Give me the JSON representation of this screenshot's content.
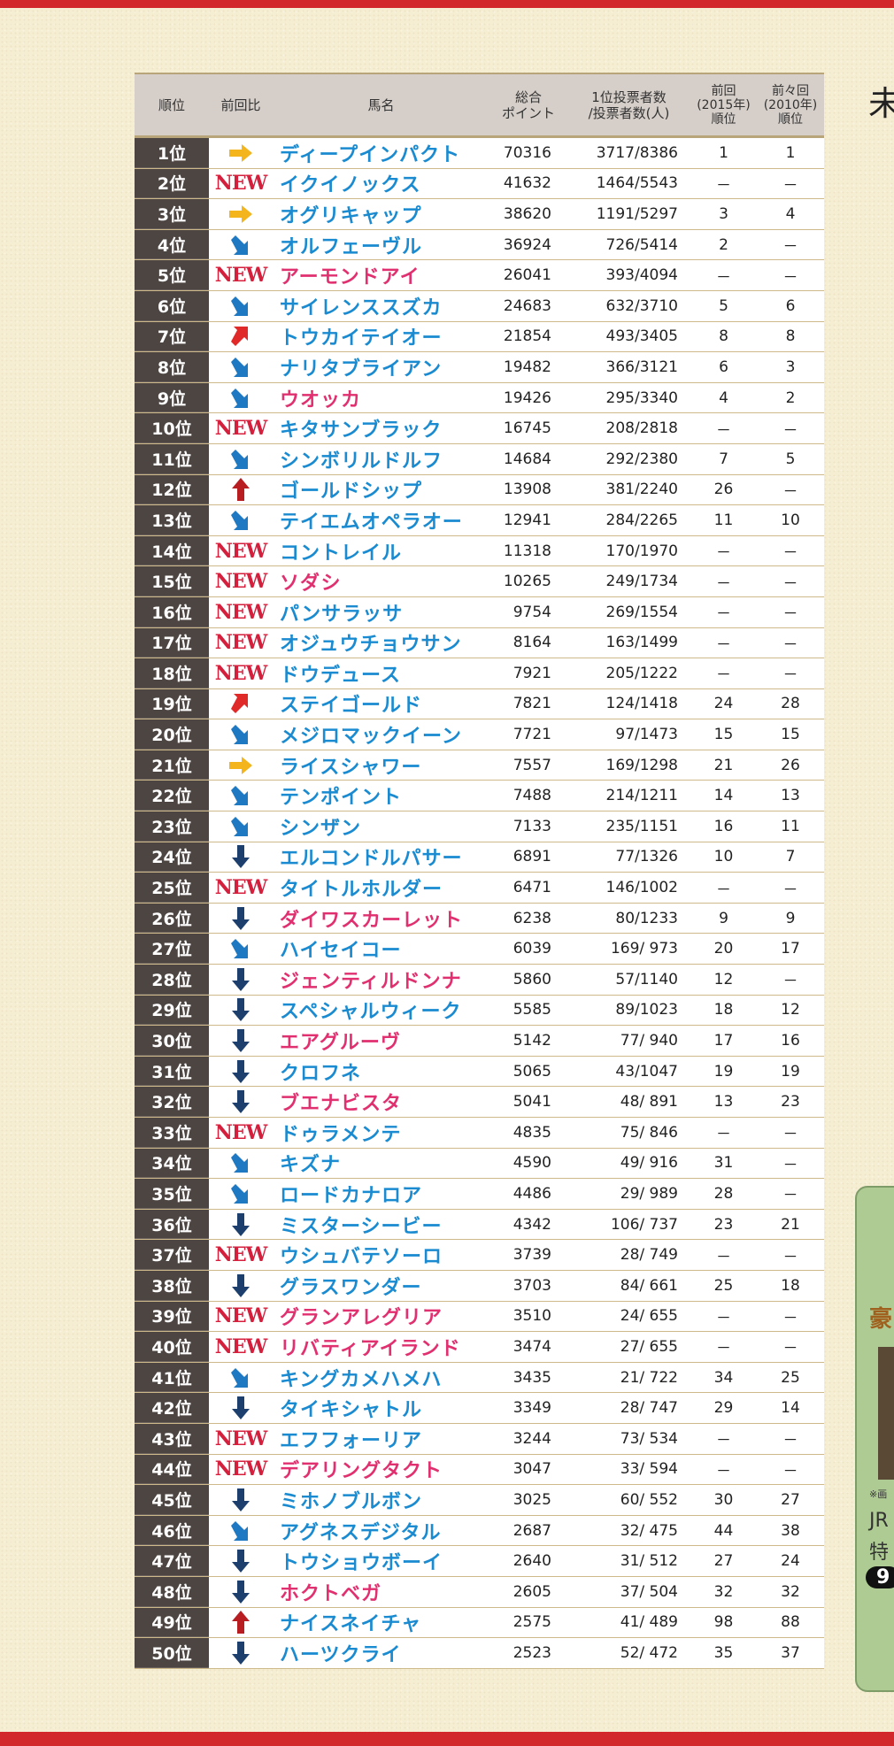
{
  "header": {
    "rank": "順位",
    "change": "前回比",
    "name": "馬名",
    "points": "総合\nポイント",
    "votes": "1位投票者数\n/投票者数(人)",
    "prev": "前回\n(2015年)\n順位",
    "prev2": "前々回\n(2010年)\n順位"
  },
  "new_label": "NEW",
  "colors": {
    "male": "#1a8bd0",
    "female": "#e1306f",
    "new": "#d41f3d",
    "accent_red": "#d3282b"
  },
  "side": {
    "title_char": "未",
    "panel_texts": [
      "豪",
      "※画",
      "JR",
      "特",
      "9"
    ]
  },
  "rows": [
    {
      "rank": "1位",
      "change": "same",
      "name": "ディープインパクト",
      "sex": "m",
      "points": "70316",
      "votes": "3717/8386",
      "prev": "1",
      "prev2": "1"
    },
    {
      "rank": "2位",
      "change": "new",
      "name": "イクイノックス",
      "sex": "m",
      "points": "41632",
      "votes": "1464/5543",
      "prev": "－",
      "prev2": "－"
    },
    {
      "rank": "3位",
      "change": "same",
      "name": "オグリキャップ",
      "sex": "m",
      "points": "38620",
      "votes": "1191/5297",
      "prev": "3",
      "prev2": "4"
    },
    {
      "rank": "4位",
      "change": "down-slight",
      "name": "オルフェーヴル",
      "sex": "m",
      "points": "36924",
      "votes": "726/5414",
      "prev": "2",
      "prev2": "－"
    },
    {
      "rank": "5位",
      "change": "new",
      "name": "アーモンドアイ",
      "sex": "f",
      "points": "26041",
      "votes": "393/4094",
      "prev": "－",
      "prev2": "－"
    },
    {
      "rank": "6位",
      "change": "down-slight",
      "name": "サイレンススズカ",
      "sex": "m",
      "points": "24683",
      "votes": "632/3710",
      "prev": "5",
      "prev2": "6"
    },
    {
      "rank": "7位",
      "change": "up-slight",
      "name": "トウカイテイオー",
      "sex": "m",
      "points": "21854",
      "votes": "493/3405",
      "prev": "8",
      "prev2": "8"
    },
    {
      "rank": "8位",
      "change": "down-slight",
      "name": "ナリタブライアン",
      "sex": "m",
      "points": "19482",
      "votes": "366/3121",
      "prev": "6",
      "prev2": "3"
    },
    {
      "rank": "9位",
      "change": "down-slight",
      "name": "ウオッカ",
      "sex": "f",
      "points": "19426",
      "votes": "295/3340",
      "prev": "4",
      "prev2": "2"
    },
    {
      "rank": "10位",
      "change": "new",
      "name": "キタサンブラック",
      "sex": "m",
      "points": "16745",
      "votes": "208/2818",
      "prev": "－",
      "prev2": "－"
    },
    {
      "rank": "11位",
      "change": "down-slight",
      "name": "シンボリルドルフ",
      "sex": "m",
      "points": "14684",
      "votes": "292/2380",
      "prev": "7",
      "prev2": "5"
    },
    {
      "rank": "12位",
      "change": "up",
      "name": "ゴールドシップ",
      "sex": "m",
      "points": "13908",
      "votes": "381/2240",
      "prev": "26",
      "prev2": "－"
    },
    {
      "rank": "13位",
      "change": "down-slight",
      "name": "テイエムオペラオー",
      "sex": "m",
      "points": "12941",
      "votes": "284/2265",
      "prev": "11",
      "prev2": "10"
    },
    {
      "rank": "14位",
      "change": "new",
      "name": "コントレイル",
      "sex": "m",
      "points": "11318",
      "votes": "170/1970",
      "prev": "－",
      "prev2": "－"
    },
    {
      "rank": "15位",
      "change": "new",
      "name": "ソダシ",
      "sex": "f",
      "points": "10265",
      "votes": "249/1734",
      "prev": "－",
      "prev2": "－"
    },
    {
      "rank": "16位",
      "change": "new",
      "name": "パンサラッサ",
      "sex": "m",
      "points": "9754",
      "votes": "269/1554",
      "prev": "－",
      "prev2": "－"
    },
    {
      "rank": "17位",
      "change": "new",
      "name": "オジュウチョウサン",
      "sex": "m",
      "points": "8164",
      "votes": "163/1499",
      "prev": "－",
      "prev2": "－"
    },
    {
      "rank": "18位",
      "change": "new",
      "name": "ドウデュース",
      "sex": "m",
      "points": "7921",
      "votes": "205/1222",
      "prev": "－",
      "prev2": "－"
    },
    {
      "rank": "19位",
      "change": "up-slight",
      "name": "ステイゴールド",
      "sex": "m",
      "points": "7821",
      "votes": "124/1418",
      "prev": "24",
      "prev2": "28"
    },
    {
      "rank": "20位",
      "change": "down-slight",
      "name": "メジロマックイーン",
      "sex": "m",
      "points": "7721",
      "votes": "97/1473",
      "prev": "15",
      "prev2": "15"
    },
    {
      "rank": "21位",
      "change": "same",
      "name": "ライスシャワー",
      "sex": "m",
      "points": "7557",
      "votes": "169/1298",
      "prev": "21",
      "prev2": "26"
    },
    {
      "rank": "22位",
      "change": "down-slight",
      "name": "テンポイント",
      "sex": "m",
      "points": "7488",
      "votes": "214/1211",
      "prev": "14",
      "prev2": "13"
    },
    {
      "rank": "23位",
      "change": "down-slight",
      "name": "シンザン",
      "sex": "m",
      "points": "7133",
      "votes": "235/1151",
      "prev": "16",
      "prev2": "11"
    },
    {
      "rank": "24位",
      "change": "down",
      "name": "エルコンドルパサー",
      "sex": "m",
      "points": "6891",
      "votes": "77/1326",
      "prev": "10",
      "prev2": "7"
    },
    {
      "rank": "25位",
      "change": "new",
      "name": "タイトルホルダー",
      "sex": "m",
      "points": "6471",
      "votes": "146/1002",
      "prev": "－",
      "prev2": "－"
    },
    {
      "rank": "26位",
      "change": "down",
      "name": "ダイワスカーレット",
      "sex": "f",
      "points": "6238",
      "votes": "80/1233",
      "prev": "9",
      "prev2": "9"
    },
    {
      "rank": "27位",
      "change": "down-slight",
      "name": "ハイセイコー",
      "sex": "m",
      "points": "6039",
      "votes": "169/ 973",
      "prev": "20",
      "prev2": "17"
    },
    {
      "rank": "28位",
      "change": "down",
      "name": "ジェンティルドンナ",
      "sex": "f",
      "points": "5860",
      "votes": "57/1140",
      "prev": "12",
      "prev2": "－"
    },
    {
      "rank": "29位",
      "change": "down",
      "name": "スペシャルウィーク",
      "sex": "m",
      "points": "5585",
      "votes": "89/1023",
      "prev": "18",
      "prev2": "12"
    },
    {
      "rank": "30位",
      "change": "down",
      "name": "エアグルーヴ",
      "sex": "f",
      "points": "5142",
      "votes": "77/ 940",
      "prev": "17",
      "prev2": "16"
    },
    {
      "rank": "31位",
      "change": "down",
      "name": "クロフネ",
      "sex": "m",
      "points": "5065",
      "votes": "43/1047",
      "prev": "19",
      "prev2": "19"
    },
    {
      "rank": "32位",
      "change": "down",
      "name": "ブエナビスタ",
      "sex": "f",
      "points": "5041",
      "votes": "48/ 891",
      "prev": "13",
      "prev2": "23"
    },
    {
      "rank": "33位",
      "change": "new",
      "name": "ドゥラメンテ",
      "sex": "m",
      "points": "4835",
      "votes": "75/ 846",
      "prev": "－",
      "prev2": "－"
    },
    {
      "rank": "34位",
      "change": "down-slight",
      "name": "キズナ",
      "sex": "m",
      "points": "4590",
      "votes": "49/ 916",
      "prev": "31",
      "prev2": "－"
    },
    {
      "rank": "35位",
      "change": "down-slight",
      "name": "ロードカナロア",
      "sex": "m",
      "points": "4486",
      "votes": "29/ 989",
      "prev": "28",
      "prev2": "－"
    },
    {
      "rank": "36位",
      "change": "down",
      "name": "ミスターシービー",
      "sex": "m",
      "points": "4342",
      "votes": "106/ 737",
      "prev": "23",
      "prev2": "21"
    },
    {
      "rank": "37位",
      "change": "new",
      "name": "ウシュバテソーロ",
      "sex": "m",
      "points": "3739",
      "votes": "28/ 749",
      "prev": "－",
      "prev2": "－"
    },
    {
      "rank": "38位",
      "change": "down",
      "name": "グラスワンダー",
      "sex": "m",
      "points": "3703",
      "votes": "84/ 661",
      "prev": "25",
      "prev2": "18"
    },
    {
      "rank": "39位",
      "change": "new",
      "name": "グランアレグリア",
      "sex": "f",
      "points": "3510",
      "votes": "24/ 655",
      "prev": "－",
      "prev2": "－"
    },
    {
      "rank": "40位",
      "change": "new",
      "name": "リバティアイランド",
      "sex": "f",
      "points": "3474",
      "votes": "27/ 655",
      "prev": "－",
      "prev2": "－"
    },
    {
      "rank": "41位",
      "change": "down-slight",
      "name": "キングカメハメハ",
      "sex": "m",
      "points": "3435",
      "votes": "21/ 722",
      "prev": "34",
      "prev2": "25"
    },
    {
      "rank": "42位",
      "change": "down",
      "name": "タイキシャトル",
      "sex": "m",
      "points": "3349",
      "votes": "28/ 747",
      "prev": "29",
      "prev2": "14"
    },
    {
      "rank": "43位",
      "change": "new",
      "name": "エフフォーリア",
      "sex": "m",
      "points": "3244",
      "votes": "73/ 534",
      "prev": "－",
      "prev2": "－"
    },
    {
      "rank": "44位",
      "change": "new",
      "name": "デアリングタクト",
      "sex": "f",
      "points": "3047",
      "votes": "33/ 594",
      "prev": "－",
      "prev2": "－"
    },
    {
      "rank": "45位",
      "change": "down",
      "name": "ミホノブルボン",
      "sex": "m",
      "points": "3025",
      "votes": "60/ 552",
      "prev": "30",
      "prev2": "27"
    },
    {
      "rank": "46位",
      "change": "down-slight",
      "name": "アグネスデジタル",
      "sex": "m",
      "points": "2687",
      "votes": "32/ 475",
      "prev": "44",
      "prev2": "38"
    },
    {
      "rank": "47位",
      "change": "down",
      "name": "トウショウボーイ",
      "sex": "m",
      "points": "2640",
      "votes": "31/ 512",
      "prev": "27",
      "prev2": "24"
    },
    {
      "rank": "48位",
      "change": "down",
      "name": "ホクトベガ",
      "sex": "f",
      "points": "2605",
      "votes": "37/ 504",
      "prev": "32",
      "prev2": "32"
    },
    {
      "rank": "49位",
      "change": "up",
      "name": "ナイスネイチャ",
      "sex": "m",
      "points": "2575",
      "votes": "41/ 489",
      "prev": "98",
      "prev2": "88"
    },
    {
      "rank": "50位",
      "change": "down",
      "name": "ハーツクライ",
      "sex": "m",
      "points": "2523",
      "votes": "52/ 472",
      "prev": "35",
      "prev2": "37"
    }
  ]
}
